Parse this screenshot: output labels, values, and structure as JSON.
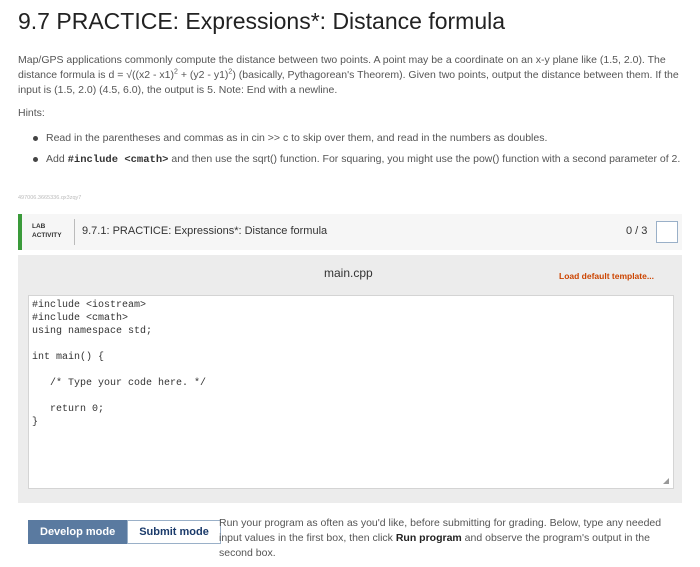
{
  "page": {
    "title": "9.7 PRACTICE: Expressions*: Distance formula",
    "description": {
      "part1": "Map/GPS applications commonly compute the distance between two points. A point may be a coordinate on an x-y plane like (1.5, 2.0). The distance formula is d = √((x2 - x1)",
      "sup1": "2",
      "part2": " + (y2 - y1)",
      "sup2": "2",
      "part3": ") (basically, Pythagorean's Theorem). Given two points, output the distance between them. If the input is (1.5, 2.0) (4.5, 6.0), the output is 5. Note: End with a newline."
    },
    "hints_label": "Hints:",
    "hints": [
      {
        "text": "Read in the parentheses and commas as in cin >> c to skip over them, and read in the numbers as doubles."
      },
      {
        "before": "Add ",
        "code": "#include <cmath>",
        "after": " and then use the sqrt() function. For squaring, you might use the pow() function with a second parameter of 2."
      }
    ],
    "tiny_id": "497006.3665336.qx3zqy7"
  },
  "lab": {
    "tag_line1": "LAB",
    "tag_line2": "ACTIVITY",
    "title": "9.7.1: PRACTICE: Expressions*: Distance formula",
    "score": "0 / 3"
  },
  "editor": {
    "file_name": "main.cpp",
    "load_default": "Load default template...",
    "code_lines": [
      "#include <iostream>",
      "#include <cmath>",
      "using namespace std;",
      "",
      "int main() {",
      "",
      "   /* Type your code here. */",
      "",
      "   return 0;",
      "}"
    ]
  },
  "modes": {
    "develop_label": "Develop mode",
    "submit_label": "Submit mode"
  },
  "run_info": {
    "part1": "Run your program as often as you'd like, before submitting for grading. Below, type any needed input values in the first box, then click ",
    "bold": "Run program",
    "part2": " and observe the program's output in the second box."
  },
  "colors": {
    "accent_green": "#3a9a3a",
    "active_mode": "#5a7aa0",
    "load_default": "#cc4400"
  }
}
